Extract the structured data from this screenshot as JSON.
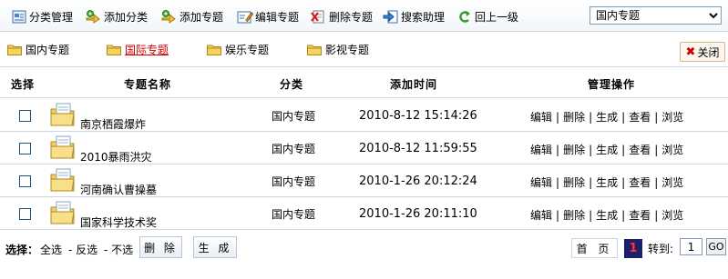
{
  "toolbar": {
    "items": [
      {
        "label": "分类管理",
        "icon": "category-manage-icon"
      },
      {
        "label": "添加分类",
        "icon": "add-category-icon"
      },
      {
        "label": "添加专题",
        "icon": "add-topic-icon"
      },
      {
        "label": "编辑专题",
        "icon": "edit-topic-icon"
      },
      {
        "label": "删除专题",
        "icon": "delete-topic-icon"
      },
      {
        "label": "搜索助理",
        "icon": "search-assistant-icon"
      },
      {
        "label": "回上一级",
        "icon": "back-up-icon"
      }
    ],
    "select_value": "国内专题"
  },
  "tabs": [
    {
      "label": "国内专题",
      "active": false
    },
    {
      "label": "国际专题",
      "active": true
    },
    {
      "label": "娱乐专题",
      "active": false
    },
    {
      "label": "影视专题",
      "active": false
    }
  ],
  "close_label": "关闭",
  "table": {
    "headers": {
      "select": "选择",
      "name": "专题名称",
      "category": "分类",
      "time": "添加时间",
      "ops": "管理操作"
    },
    "rows": [
      {
        "name": "南京栖霞爆炸",
        "category": "国内专题",
        "time": "2010-8-12 15:14:26"
      },
      {
        "name": "2010暴雨洪灾",
        "category": "国内专题",
        "time": "2010-8-12 11:59:55"
      },
      {
        "name": "河南确认曹操墓",
        "category": "国内专题",
        "time": "2010-1-26 20:12:24"
      },
      {
        "name": "国家科学技术奖",
        "category": "国内专题",
        "time": "2010-1-26 20:11:10"
      }
    ],
    "ops": [
      "编辑",
      "删除",
      "生成",
      "查看",
      "浏览"
    ]
  },
  "footer": {
    "select_label": "选择：",
    "select_all": "全选",
    "invert": "- 反选",
    "none": "- 不选",
    "delete_btn": "删 除",
    "generate_btn": "生 成",
    "first_page": "首 页",
    "current_page": "1",
    "goto_label": "转到:",
    "goto_value": "1",
    "go_btn": "GO"
  },
  "colors": {
    "active_tab": "#cc0000",
    "border": "#c9d6e2",
    "current_page_bg": "#1a1f6e",
    "current_page_text": "#ff3333"
  }
}
